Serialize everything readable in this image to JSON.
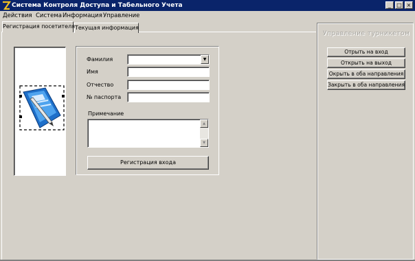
{
  "window": {
    "title": "Система Контроля Доступа и Табельного Учета",
    "minimize_glyph": "_",
    "maximize_glyph": "□",
    "close_glyph": "×"
  },
  "menu": [
    "Действия",
    "Система",
    "Информация",
    "Управление"
  ],
  "tabs": [
    {
      "label": "Регистрация посетителя",
      "active": true
    },
    {
      "label": "Текущая информация",
      "active": false
    }
  ],
  "form": {
    "surname_label": "Фамилия",
    "surname_value": "",
    "name_label": "Имя",
    "name_value": "",
    "patronymic_label": "Отчество",
    "patronymic_value": "",
    "passport_label": "№ паспорта",
    "passport_value": "",
    "notes_label": "Примечание",
    "notes_value": "",
    "register_button": "Регистрация входа"
  },
  "turnstile": {
    "title": "Управление турникетом",
    "buttons": [
      "Отрыть на вход",
      "Открыть на выход",
      "Окрыть в оба направления",
      "Закрыть в оба направления"
    ]
  },
  "icons": {
    "app": "app-logo-icon",
    "photo": "document-pen-icon",
    "dropdown": "chevron-down-icon"
  },
  "colors": {
    "titlebar": "#0a246a",
    "face": "#d4d0c8",
    "icon_blue": "#1e6fc9"
  }
}
